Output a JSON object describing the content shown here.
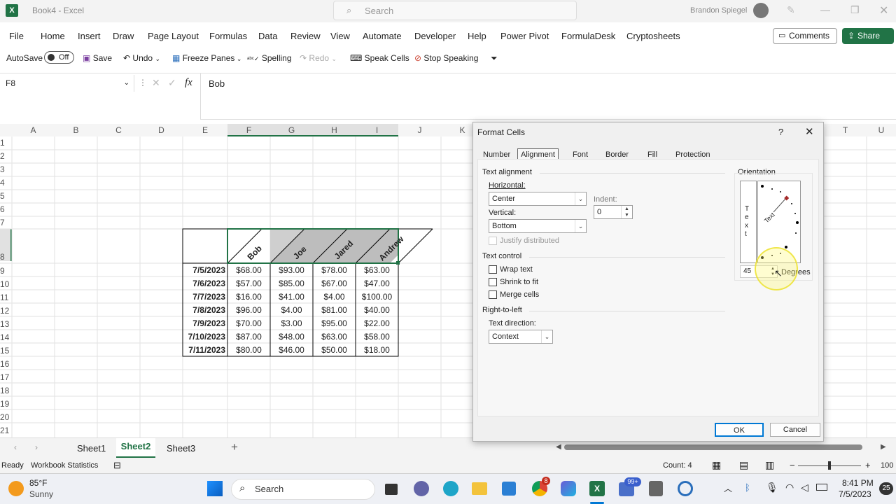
{
  "app": {
    "window_title": "Book4 - Excel",
    "search_placeholder": "Search",
    "user": "Brandon Spiegel"
  },
  "menu": [
    "File",
    "Home",
    "Insert",
    "Draw",
    "Page Layout",
    "Formulas",
    "Data",
    "Review",
    "View",
    "Automate",
    "Developer",
    "Help",
    "Power Pivot",
    "FormulaDesk",
    "Cryptosheets"
  ],
  "header_buttons": {
    "comments": "Comments",
    "share": "Share"
  },
  "qat": {
    "autosave": "AutoSave",
    "autosave_state": "Off",
    "save": "Save",
    "undo": "Undo",
    "freeze": "Freeze Panes",
    "spelling": "Spelling",
    "redo": "Redo",
    "speak": "Speak Cells",
    "stop": "Stop Speaking"
  },
  "formula": {
    "namebox": "F8",
    "value": "Bob",
    "fx": "fx"
  },
  "columns": [
    "A",
    "B",
    "C",
    "D",
    "E",
    "F",
    "G",
    "H",
    "I",
    "J",
    "K",
    "T",
    "U"
  ],
  "rows": [
    "1",
    "2",
    "3",
    "4",
    "5",
    "6",
    "7",
    "8",
    "9",
    "10",
    "11",
    "12",
    "13",
    "14",
    "15",
    "16",
    "17",
    "18",
    "19",
    "20",
    "21"
  ],
  "table": {
    "headers": [
      "Bob",
      "Joe",
      "Jared",
      "Andrew"
    ],
    "rows": [
      {
        "date": "7/5/2023",
        "values": [
          "$68.00",
          "$93.00",
          "$78.00",
          "$63.00"
        ]
      },
      {
        "date": "7/6/2023",
        "values": [
          "$57.00",
          "$85.00",
          "$67.00",
          "$47.00"
        ]
      },
      {
        "date": "7/7/2023",
        "values": [
          "$16.00",
          "$41.00",
          "$4.00",
          "$100.00"
        ]
      },
      {
        "date": "7/8/2023",
        "values": [
          "$96.00",
          "$4.00",
          "$81.00",
          "$40.00"
        ]
      },
      {
        "date": "7/9/2023",
        "values": [
          "$70.00",
          "$3.00",
          "$95.00",
          "$22.00"
        ]
      },
      {
        "date": "7/10/2023",
        "values": [
          "$87.00",
          "$48.00",
          "$63.00",
          "$58.00"
        ]
      },
      {
        "date": "7/11/2023",
        "values": [
          "$80.00",
          "$46.00",
          "$50.00",
          "$18.00"
        ]
      }
    ]
  },
  "dialog": {
    "title": "Format Cells",
    "help": "?",
    "tabs": [
      "Number",
      "Alignment",
      "Font",
      "Border",
      "Fill",
      "Protection"
    ],
    "text_alignment": "Text alignment",
    "horizontal_label": "Horizontal:",
    "horizontal_value": "Center",
    "indent_label": "Indent:",
    "indent_value": "0",
    "vertical_label": "Vertical:",
    "vertical_value": "Bottom",
    "justify": "Justify distributed",
    "text_control": "Text control",
    "wrap": "Wrap text",
    "shrink": "Shrink to fit",
    "merge": "Merge cells",
    "rtl": "Right-to-left",
    "direction_label": "Text direction:",
    "direction_value": "Context",
    "orientation": "Orientation",
    "vertical_text": "T e x t",
    "rotated_text": "Text",
    "degrees_value": "45",
    "degrees_label": "Degrees",
    "ok": "OK",
    "cancel": "Cancel"
  },
  "sheets": [
    "Sheet1",
    "Sheet2",
    "Sheet3"
  ],
  "status": {
    "ready": "Ready",
    "workbook_stats": "Workbook Statistics",
    "count": "Count: 4",
    "zoom": "100"
  },
  "taskbar": {
    "temp": "85°F",
    "weather": "Sunny",
    "search": "Search",
    "time": "8:41 PM",
    "date": "7/5/2023",
    "badge": "99+",
    "badge2": "8",
    "notif": "25"
  },
  "colors": {
    "excel_green": "#217346",
    "accent": "#0078d4",
    "header_gray": "#c0c0c0"
  }
}
